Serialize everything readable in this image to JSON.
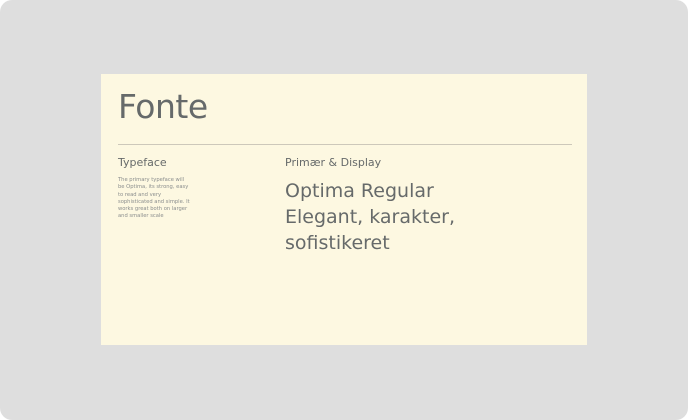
{
  "slide": {
    "title": "Fonte",
    "typeface": {
      "label": "Typeface",
      "description": "The primary typeface will be Optima, its strong, easy to read and very sophisticated and simple. It works great both on larger and smaller scale"
    },
    "display": {
      "label": "Primær & Display",
      "sample": "Optima Regular\nElegant, karakter,\nsofistikeret"
    }
  }
}
